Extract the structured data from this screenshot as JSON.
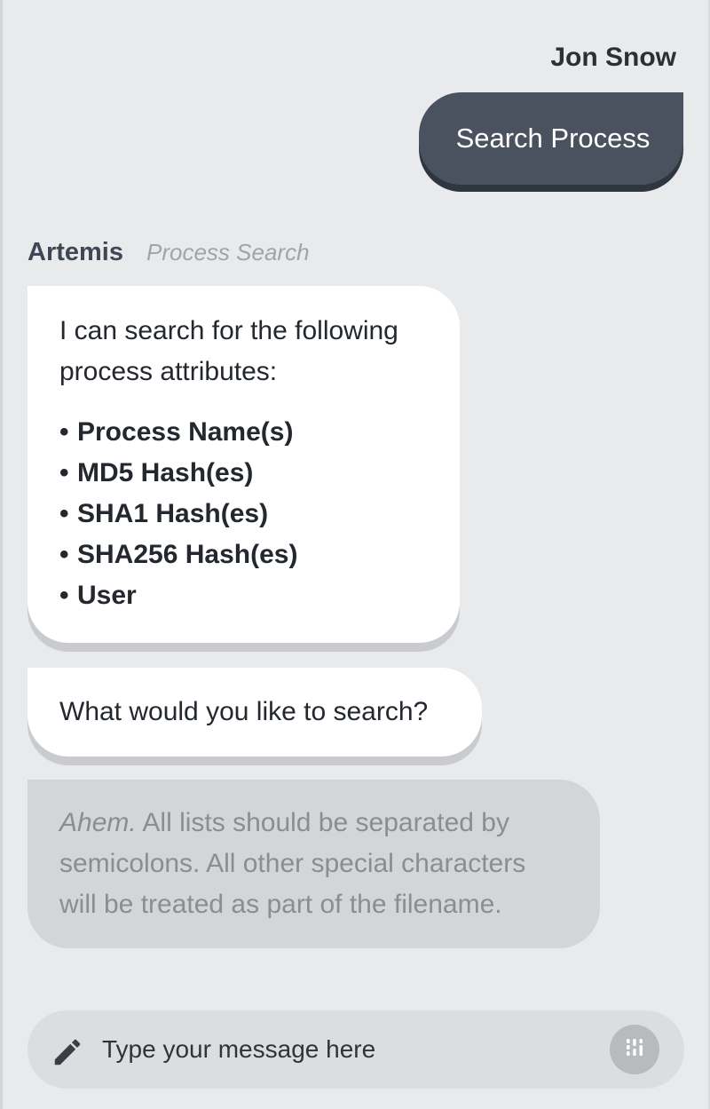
{
  "header": {
    "user_name": "Jon Snow"
  },
  "user_message": {
    "text": "Search Process"
  },
  "bot": {
    "name": "Artemis",
    "context": "Process Search"
  },
  "bot_messages": {
    "intro": "I can search for the following process attributes:",
    "attributes": [
      "Process Name(s)",
      "MD5 Hash(es)",
      "SHA1 Hash(es)",
      "SHA256 Hash(es)",
      "User"
    ],
    "bullet": "•",
    "question": "What would you like to search?"
  },
  "warning": {
    "emphasis": "Ahem.",
    "text": " All lists should be separated by semicolons. All other special characters will be treated as part of the filename."
  },
  "composer": {
    "placeholder": "Type your message here",
    "value": ""
  },
  "colors": {
    "background": "#e9eaec",
    "user_bubble": "#4a5260",
    "bot_bubble": "#ffffff",
    "warning_bubble": "#d4d5d6"
  },
  "icons": {
    "composer_left": "pencil-icon",
    "composer_right": "options-icon"
  }
}
